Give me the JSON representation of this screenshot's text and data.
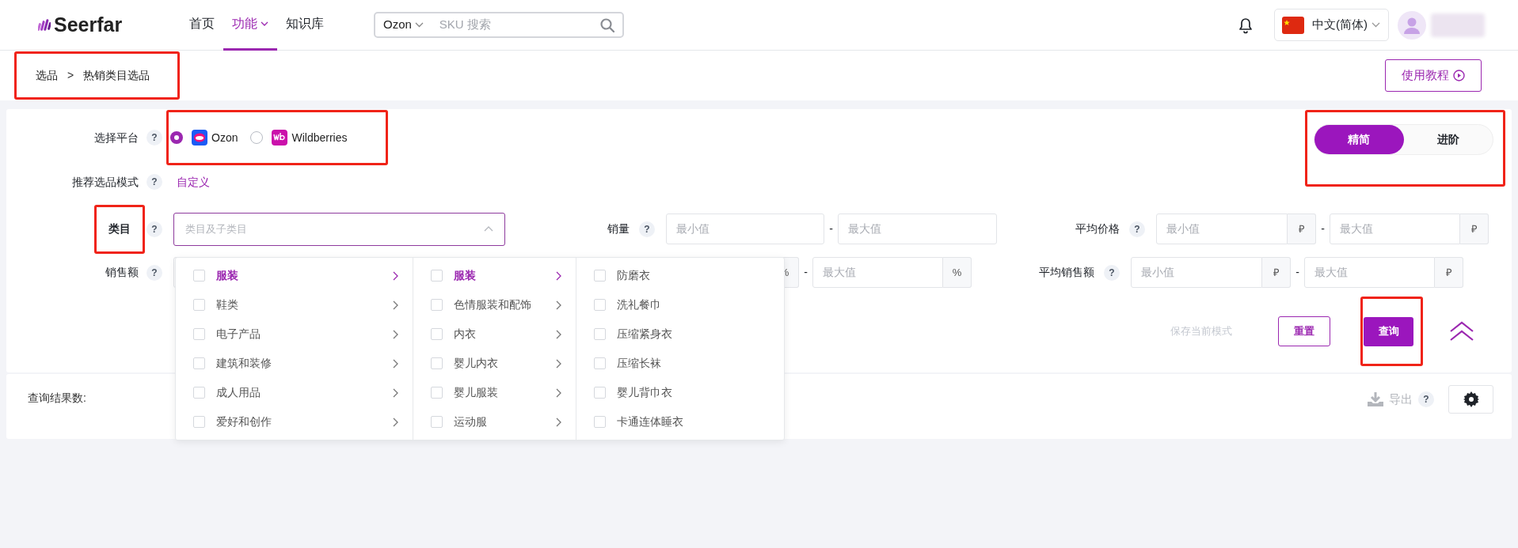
{
  "header": {
    "logo": "Seerfar",
    "nav": [
      {
        "label": "首页",
        "selected": false,
        "dropdown": false
      },
      {
        "label": "功能",
        "selected": true,
        "dropdown": true
      },
      {
        "label": "知识库",
        "selected": false,
        "dropdown": false
      }
    ],
    "search": {
      "platform": "Ozon",
      "placeholder": "SKU 搜索"
    },
    "language": "中文(简体)"
  },
  "breadcrumb": {
    "highlighted": true,
    "separator": ">",
    "items": [
      "选品",
      "热销类目选品"
    ]
  },
  "tutorial_button": "使用教程",
  "platform": {
    "label": "选择平台",
    "help": "?",
    "highlighted": true,
    "options": [
      {
        "label": "Ozon",
        "selected": true
      },
      {
        "label": "Wildberries",
        "selected": false
      }
    ]
  },
  "view_toggle": {
    "highlighted": true,
    "options": [
      {
        "label": "精简",
        "selected": true
      },
      {
        "label": "进阶",
        "selected": false
      }
    ]
  },
  "mode": {
    "label": "推荐选品模式",
    "help": "?",
    "value": "自定义"
  },
  "filter_rows": [
    {
      "cells": [
        {
          "kind": "select",
          "label": "类目",
          "help": "?",
          "highlighted": true,
          "placeholder": "类目及子类目",
          "expanded": true
        },
        {
          "kind": "range",
          "label": "销量",
          "help": "?",
          "min": {
            "placeholder": "最小值"
          },
          "separator": "-",
          "max": {
            "placeholder": "最大值"
          }
        },
        {
          "kind": "range",
          "label": "平均价格",
          "help": "?",
          "unit": "₽",
          "min": {
            "placeholder": "最小值"
          },
          "separator": "-",
          "max": {
            "placeholder": "最大值"
          }
        }
      ]
    },
    {
      "cells": [
        {
          "kind": "covered",
          "label": "销售额",
          "help": "?"
        },
        {
          "kind": "range",
          "unit": "%",
          "separator": "-",
          "max": {
            "placeholder": "最大值"
          }
        },
        {
          "kind": "range",
          "label": "平均销售额",
          "help": "?",
          "unit": "₽",
          "min": {
            "placeholder": "最小值"
          },
          "separator": "-",
          "max": {
            "placeholder": "最大值"
          }
        }
      ]
    }
  ],
  "category_menu": [
    {
      "items": [
        {
          "label": "服装",
          "selected": true,
          "has_children": true
        },
        {
          "label": "鞋类",
          "selected": false,
          "has_children": true
        },
        {
          "label": "电子产品",
          "selected": false,
          "has_children": true
        },
        {
          "label": "建筑和装修",
          "selected": false,
          "has_children": true
        },
        {
          "label": "成人用品",
          "selected": false,
          "has_children": true
        },
        {
          "label": "爱好和创作",
          "selected": false,
          "has_children": true
        }
      ]
    },
    {
      "items": [
        {
          "label": "服装",
          "selected": true,
          "has_children": true
        },
        {
          "label": "色情服装和配饰",
          "selected": false,
          "has_children": true
        },
        {
          "label": "内衣",
          "selected": false,
          "has_children": true
        },
        {
          "label": "婴儿内衣",
          "selected": false,
          "has_children": true
        },
        {
          "label": "婴儿服装",
          "selected": false,
          "has_children": true
        },
        {
          "label": "运动服",
          "selected": false,
          "has_children": true
        }
      ]
    },
    {
      "items": [
        {
          "label": "防磨衣",
          "selected": false,
          "has_children": false
        },
        {
          "label": "洗礼餐巾",
          "selected": false,
          "has_children": false
        },
        {
          "label": "压缩紧身衣",
          "selected": false,
          "has_children": false
        },
        {
          "label": "压缩长袜",
          "selected": false,
          "has_children": false
        },
        {
          "label": "婴儿背巾衣",
          "selected": false,
          "has_children": false
        },
        {
          "label": "卡通连体睡衣",
          "selected": false,
          "has_children": false
        }
      ]
    }
  ],
  "actions": {
    "save_mode": {
      "label": "保存当前模式",
      "disabled": true
    },
    "reset": "重置",
    "query": {
      "label": "查询",
      "highlighted": true
    }
  },
  "results": {
    "label": "查询结果数:",
    "export": {
      "label": "导出",
      "disabled": true,
      "help": "?"
    }
  }
}
